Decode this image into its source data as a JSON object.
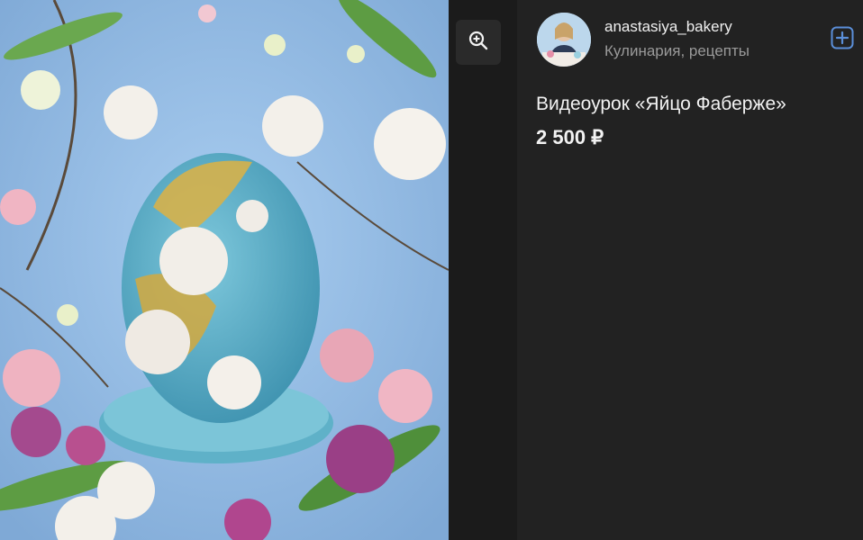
{
  "viewer": {
    "zoom_icon": "zoom-in-icon",
    "image_alt": "Faberge egg cake with tulips"
  },
  "author": {
    "name": "anastasiya_bakery",
    "subtitle": "Кулинария, рецепты",
    "add_icon": "plus-square-icon"
  },
  "product": {
    "title": "Видеоурок «Яйцо Фаберже»",
    "price": "2 500 ₽"
  },
  "colors": {
    "accent": "#5b8fd9",
    "background": "#222222"
  }
}
